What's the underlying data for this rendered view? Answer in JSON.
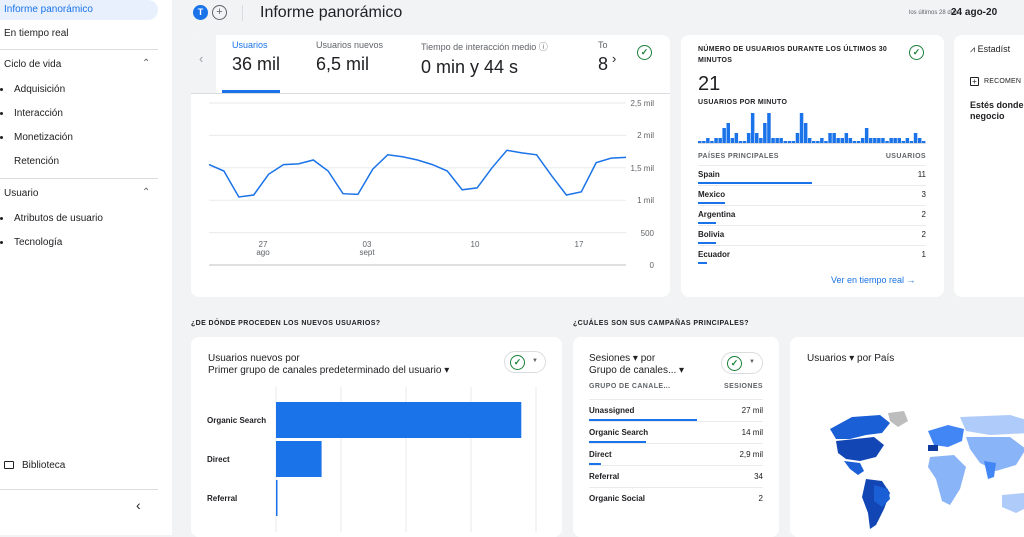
{
  "sidebar": {
    "active_item": "Informe panorámico",
    "realtime": "En tiempo real",
    "lifecycle": "Ciclo de vida",
    "lifecycle_items": [
      "Adquisición",
      "Interacción",
      "Monetización",
      "Retención"
    ],
    "user": "Usuario",
    "user_items": [
      "Atributos de usuario",
      "Tecnología"
    ],
    "library": "Biblioteca"
  },
  "header": {
    "avatar_letter": "T",
    "title": "Informe panorámico",
    "date_hint": "los últimos 28 días",
    "date_range": "24 ago-20"
  },
  "metrics": [
    {
      "label": "Usuarios",
      "value": "36 mil"
    },
    {
      "label": "Usuarios nuevos",
      "value": "6,5 mil"
    },
    {
      "label": "Tiempo de interacción medio ⓘ",
      "value": "0 min y 44 s"
    },
    {
      "label": "To",
      "value": "8"
    }
  ],
  "chart_data": {
    "type": "line",
    "series": [
      {
        "values": [
          1550,
          1450,
          1050,
          1080,
          1400,
          1550,
          1560,
          1620,
          1450,
          1100,
          1090,
          1480,
          1700,
          1670,
          1620,
          1550,
          1450,
          1160,
          1190,
          1500,
          1770,
          1730,
          1700,
          1380,
          1080,
          1130,
          1580,
          1650,
          1660
        ]
      }
    ],
    "yticks": [
      "2,5 mil",
      "2 mil",
      "1,5 mil",
      "1 mil",
      "500",
      "0"
    ],
    "ylim": [
      0,
      2500
    ],
    "xticks": [
      {
        "top": "27",
        "bottom": "ago"
      },
      {
        "top": "03",
        "bottom": "sept"
      },
      {
        "top": "10",
        "bottom": ""
      },
      {
        "top": "17",
        "bottom": ""
      }
    ]
  },
  "realtime": {
    "heading": "NÚMERO DE USUARIOS DURANTE LOS ÚLTIMOS 30 MINUTOS",
    "value": "21",
    "per_minute": "USUARIOS POR MINUTO",
    "per_minute_values": [
      0,
      0,
      1,
      0,
      1,
      1,
      3,
      4,
      1,
      2,
      0,
      0,
      2,
      6,
      2,
      1,
      4,
      6,
      1,
      1,
      1,
      0,
      0,
      0,
      2,
      6,
      4,
      1,
      0,
      0,
      1,
      0,
      2,
      2,
      1,
      1,
      2,
      1,
      0,
      0,
      1,
      3,
      1,
      1,
      1,
      1,
      0,
      1,
      1,
      1,
      0,
      1,
      0,
      2,
      1,
      0
    ],
    "col_country": "PAÍSES PRINCIPALES",
    "col_users": "USUARIOS",
    "rows": [
      {
        "name": "Spain",
        "value": "11",
        "share": 0.5
      },
      {
        "name": "Mexico",
        "value": "3",
        "share": 0.12
      },
      {
        "name": "Argentina",
        "value": "2",
        "share": 0.08
      },
      {
        "name": "Bolivia",
        "value": "2",
        "share": 0.08
      },
      {
        "name": "Ecuador",
        "value": "1",
        "share": 0.04
      }
    ],
    "link": "Ver en tiempo real →"
  },
  "insights": {
    "title": "⩘ Estadíst",
    "rec": "RECOMEN",
    "text": "Estés donde negocio"
  },
  "sections": {
    "acq": "¿DE DÓNDE PROCEDEN LOS NUEVOS USUARIOS?",
    "camp": "¿CUÁLES SON SUS CAMPAÑAS PRINCIPALES?"
  },
  "acquisition": {
    "title_line1": "Usuarios nuevos por",
    "title_line2": "Primer grupo de canales predeterminado del usuario ▾",
    "bars": [
      {
        "label": "Organic Search",
        "value": 5000
      },
      {
        "label": "Direct",
        "value": 930
      },
      {
        "label": "Referral",
        "value": 20
      }
    ]
  },
  "campaigns": {
    "title_line1": "Sesiones ▾ por",
    "title_line2": "Grupo de canales... ▾",
    "col_group": "GRUPO DE CANALE...",
    "col_sessions": "SESIONES",
    "rows": [
      {
        "name": "Unassigned",
        "value": "27 mil",
        "share": 0.62
      },
      {
        "name": "Organic Search",
        "value": "14 mil",
        "share": 0.33
      },
      {
        "name": "Direct",
        "value": "2,9 mil",
        "share": 0.07
      },
      {
        "name": "Referral",
        "value": "34",
        "share": 0
      },
      {
        "name": "Organic Social",
        "value": "2",
        "share": 0
      }
    ]
  },
  "map": {
    "title": "Usuarios ▾  por País"
  },
  "colors": {
    "accent": "#1a73e8",
    "green": "#188038"
  }
}
